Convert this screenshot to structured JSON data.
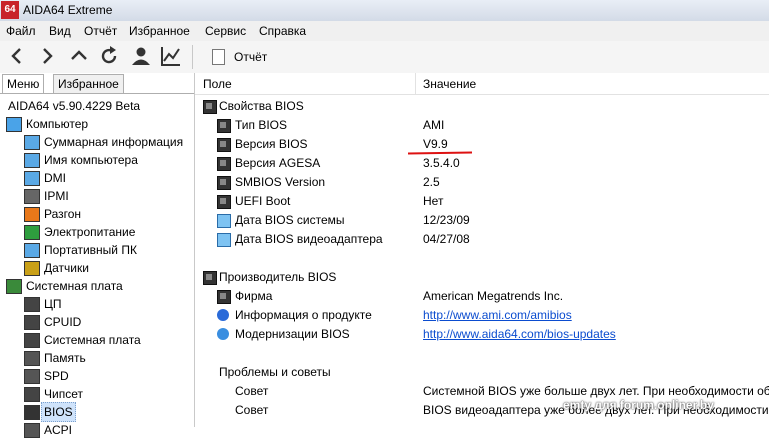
{
  "window": {
    "app_icon_text": "64",
    "title": "AIDA64 Extreme"
  },
  "menu": [
    "Файл",
    "Вид",
    "Отчёт",
    "Избранное",
    "Сервис",
    "Справка"
  ],
  "toolbar": {
    "report_label": "Отчёт"
  },
  "tabs": [
    {
      "label": "Меню",
      "active": true
    },
    {
      "label": "Избранное",
      "active": false
    }
  ],
  "tree": {
    "version": "AIDA64 v5.90.4229 Beta",
    "items": [
      {
        "label": "Компьютер",
        "icon": "computer-icon",
        "level": 0
      },
      {
        "label": "Суммарная информация",
        "icon": "summary-icon",
        "level": 1
      },
      {
        "label": "Имя компьютера",
        "icon": "computer-name-icon",
        "level": 1
      },
      {
        "label": "DMI",
        "icon": "dmi-icon",
        "level": 1
      },
      {
        "label": "IPMI",
        "icon": "ipmi-icon",
        "level": 1
      },
      {
        "label": "Разгон",
        "icon": "overclock-flame-icon",
        "level": 1
      },
      {
        "label": "Электропитание",
        "icon": "power-icon",
        "level": 1
      },
      {
        "label": "Портативный ПК",
        "icon": "laptop-icon",
        "level": 1
      },
      {
        "label": "Датчики",
        "icon": "sensor-icon",
        "level": 1
      },
      {
        "label": "Системная плата",
        "icon": "motherboard-icon",
        "level": 0
      },
      {
        "label": "ЦП",
        "icon": "cpu-icon",
        "level": 1
      },
      {
        "label": "CPUID",
        "icon": "cpuid-icon",
        "level": 1
      },
      {
        "label": "Системная плата",
        "icon": "board-icon",
        "level": 1
      },
      {
        "label": "Память",
        "icon": "memory-icon",
        "level": 1
      },
      {
        "label": "SPD",
        "icon": "spd-icon",
        "level": 1
      },
      {
        "label": "Чипсет",
        "icon": "chipset-icon",
        "level": 1
      },
      {
        "label": "BIOS",
        "icon": "bios-icon",
        "level": 1,
        "selected": true
      },
      {
        "label": "ACPI",
        "icon": "acpi-icon",
        "level": 1
      }
    ]
  },
  "columns": {
    "field": "Поле",
    "value": "Значение"
  },
  "sections": [
    {
      "title": "Свойства BIOS",
      "rows": [
        {
          "field": "Тип BIOS",
          "value": "AMI",
          "icon": "chip-icon"
        },
        {
          "field": "Версия BIOS",
          "value": "V9.9",
          "icon": "chip-icon"
        },
        {
          "field": "Версия AGESA",
          "value": "3.5.4.0",
          "icon": "chip-icon"
        },
        {
          "field": "SMBIOS Version",
          "value": "2.5",
          "icon": "chip-icon"
        },
        {
          "field": "UEFI Boot",
          "value": "Нет",
          "icon": "chip-icon"
        },
        {
          "field": "Дата BIOS системы",
          "value": "12/23/09",
          "icon": "monitor-icon"
        },
        {
          "field": "Дата BIOS видеоадаптера",
          "value": "04/27/08",
          "icon": "monitor-icon"
        }
      ]
    },
    {
      "title": "Производитель BIOS",
      "rows": [
        {
          "field": "Фирма",
          "value": "American Megatrends Inc.",
          "icon": "chip-icon"
        },
        {
          "field": "Информация о продукте",
          "value": "http://www.ami.com/amibios",
          "icon": "info-icon",
          "link": true
        },
        {
          "field": "Модернизации BIOS",
          "value": "http://www.aida64.com/bios-updates",
          "icon": "update-icon",
          "link": true
        }
      ]
    },
    {
      "title": "Проблемы и советы",
      "rows": [
        {
          "field": "Совет",
          "value": "Системной BIOS уже больше двух лет. При необходимости об..."
        },
        {
          "field": "Совет",
          "value": "BIOS видеоадаптера уже более двух лет. При необходимости..."
        }
      ]
    }
  ],
  "watermark": "emty для forum.onliner.by",
  "colors": {
    "accent": "#c8232a",
    "link": "#0b4ccf",
    "selection": "#cfe3fb",
    "annotation": "#dd1111"
  }
}
